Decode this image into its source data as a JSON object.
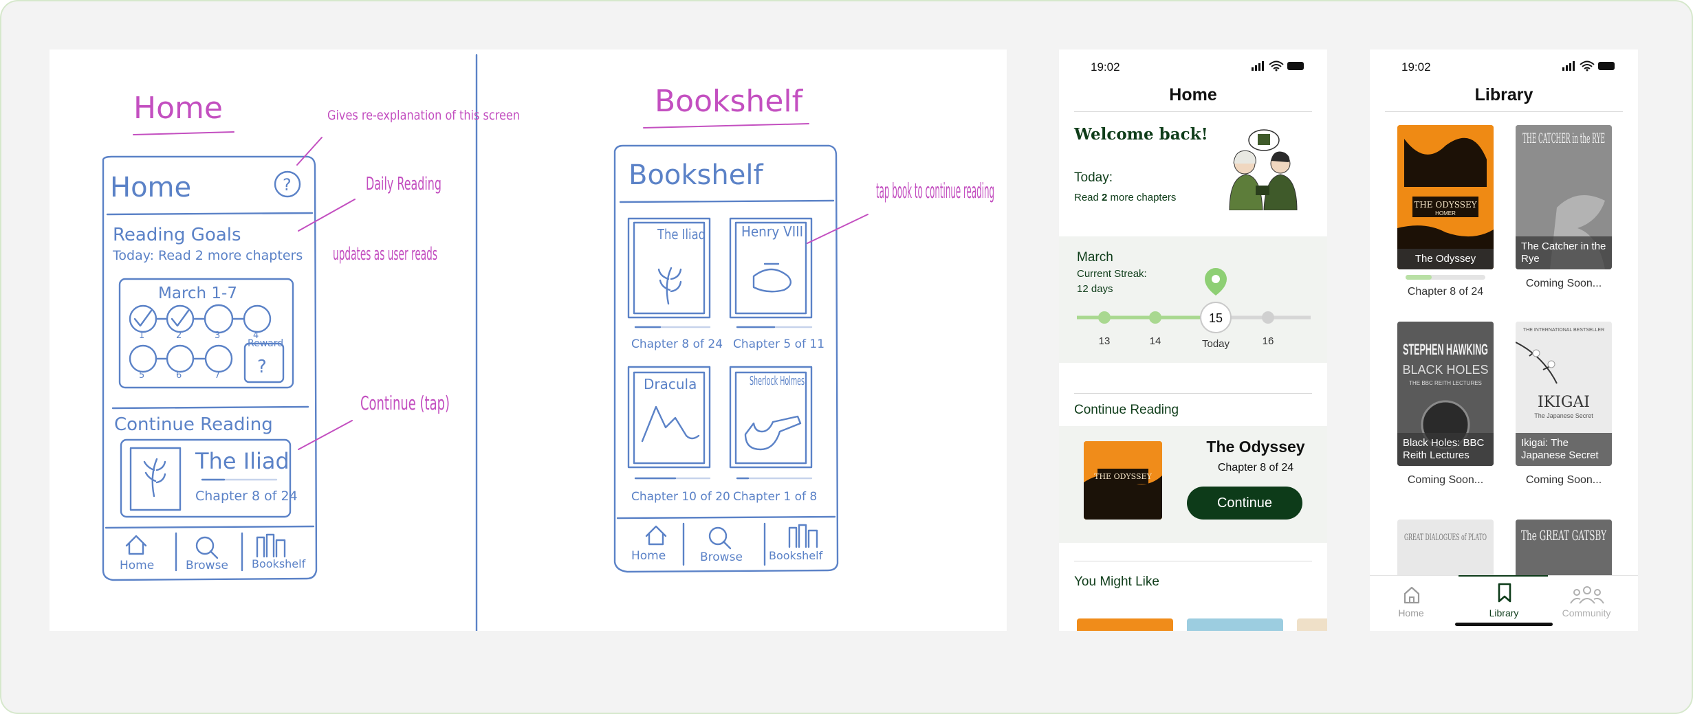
{
  "colors": {
    "brand_green": "#0d3b19",
    "accent_green": "#8ecf74",
    "sketch_blue": "#5b82c7",
    "annotation_pink": "#c34fc0"
  },
  "sketch": {
    "home": {
      "heading": "Home",
      "screen_title": "Home",
      "help_glyph": "?",
      "reading_goals": "Reading Goals",
      "today_line": "Today: Read 2 more chapters",
      "week": "March 1-7",
      "day_nums": [
        "1",
        "2",
        "3",
        "4",
        "5",
        "6",
        "7"
      ],
      "reward": "Reward",
      "reward_glyph": "?",
      "continue_reading": "Continue Reading",
      "book_title": "The Iliad",
      "book_progress": "Chapter 8 of 24",
      "nav": [
        "Home",
        "Browse",
        "Bookshelf"
      ],
      "notes": {
        "help": "Gives re-explanation of this screen",
        "goals": "Daily Reading",
        "updates": "updates as user reads",
        "continue": "Continue (tap)"
      }
    },
    "bookshelf": {
      "heading": "Bookshelf",
      "screen_title": "Bookshelf",
      "books": [
        {
          "title": "The Iliad",
          "progress": "Chapter 8 of 24"
        },
        {
          "title": "Henry VIII",
          "progress": "Chapter 5 of 11"
        },
        {
          "title": "Dracula",
          "progress": "Chapter 10 of 20"
        },
        {
          "title": "Sherlock Holmes",
          "progress": "Chapter 1 of 8"
        }
      ],
      "nav": [
        "Home",
        "Browse",
        "Bookshelf"
      ],
      "note": "tap book to continue reading"
    }
  },
  "home_screen": {
    "time": "19:02",
    "title": "Home",
    "welcome": "Welcome back!",
    "today_label": "Today:",
    "today_pre": "Read ",
    "today_count": "2",
    "today_post": " more chapters",
    "month": "March",
    "streak_label": "Current Streak:",
    "streak_days": "12 days",
    "days": [
      "13",
      "14",
      "15",
      "16"
    ],
    "today_day_label": "Today",
    "continue_heading": "Continue Reading",
    "book_title": "The Odyssey",
    "book_chapter": "Chapter 8 of 24",
    "continue_button": "Continue",
    "might_like_heading": "You Might Like"
  },
  "library_screen": {
    "time": "19:02",
    "title": "Library",
    "books": [
      {
        "cover_title": "THE ODYSSEY",
        "cover_author": "HOMER",
        "caption": "The Odyssey",
        "label": "Chapter 8 of 24",
        "progress": 0.33
      },
      {
        "cover_title": "THE CATCHER in the RYE",
        "caption": "The Catcher in the Rye",
        "label": "Coming Soon..."
      },
      {
        "cover_title": "STEPHEN HAWKING",
        "cover_sub": "BLACK HOLES",
        "cover_sub2": "THE BBC REITH LECTURES",
        "caption": "Black Holes: BBC Reith Lectures",
        "label": "Coming Soon..."
      },
      {
        "cover_title": "IKIGAI",
        "cover_sub": "The Japanese Secret",
        "cover_top": "THE INTERNATIONAL BESTSELLER",
        "caption": "Ikigai: The Japanese Secret",
        "label": "Coming Soon..."
      },
      {
        "cover_title": "GREAT DIALOGUES of PLATO"
      },
      {
        "cover_title": "The GREAT GATSBY"
      }
    ],
    "tabs": [
      "Home",
      "Library",
      "Community"
    ],
    "active_tab": "Library"
  }
}
